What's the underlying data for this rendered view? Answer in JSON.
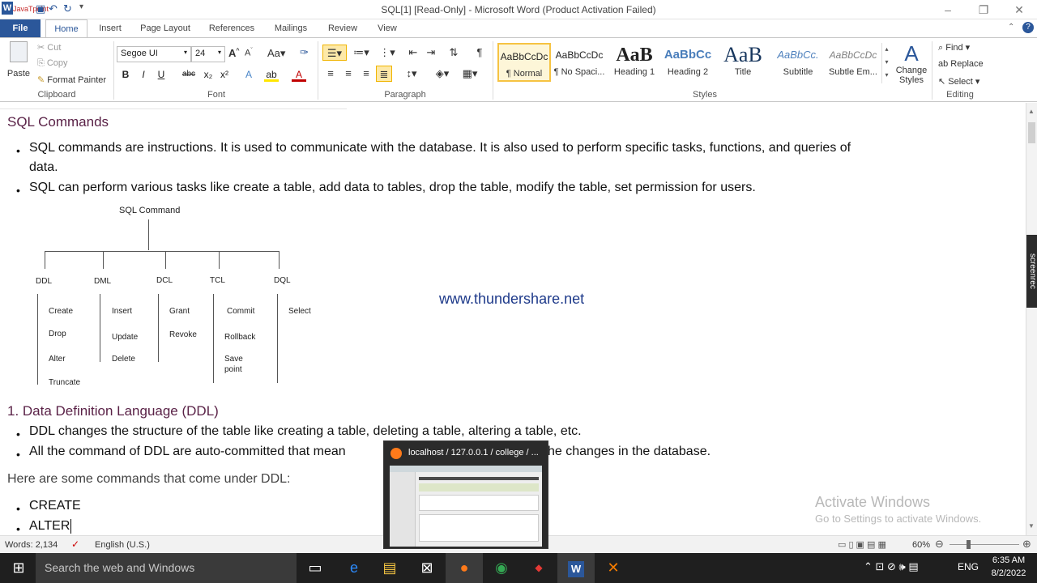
{
  "window": {
    "title": "SQL[1] [Read-Only] - Microsoft Word (Product Activation Failed)",
    "logo_text": "JavaTpoint"
  },
  "tabs": [
    "File",
    "Home",
    "Insert",
    "Page Layout",
    "References",
    "Mailings",
    "Review",
    "View"
  ],
  "clipboard": {
    "paste": "Paste",
    "cut": "Cut",
    "copy": "Copy",
    "format_painter": "Format Painter",
    "label": "Clipboard"
  },
  "font": {
    "name": "Segoe UI",
    "size": "24",
    "label": "Font"
  },
  "paragraph": {
    "label": "Paragraph"
  },
  "styles": {
    "label": "Styles",
    "items": [
      {
        "preview": "AaBbCcDc",
        "name": "¶ Normal"
      },
      {
        "preview": "AaBbCcDc",
        "name": "¶ No Spaci..."
      },
      {
        "preview": "AaB",
        "name": "Heading 1"
      },
      {
        "preview": "AaBbCc",
        "name": "Heading 2"
      },
      {
        "preview": "AaB",
        "name": "Title"
      },
      {
        "preview": "AaBbCc.",
        "name": "Subtitle"
      },
      {
        "preview": "AaBbCcDc",
        "name": "Subtle Em..."
      }
    ],
    "change_styles": "Change Styles"
  },
  "editing": {
    "find": "Find",
    "replace": "Replace",
    "select": "Select",
    "label": "Editing"
  },
  "doc": {
    "heading1": "SQL Commands",
    "bullets1": [
      "SQL commands are instructions. It is used to communicate with the database. It is also used to perform specific tasks, functions, and queries of",
      "data.",
      "SQL can perform various tasks like create a table, add data to tables, drop the table, modify the table, set permission for users."
    ],
    "diagram": {
      "root": "SQL Command",
      "branches": [
        {
          "name": "DDL",
          "items": [
            "Create",
            "Drop",
            "Alter",
            "Truncate"
          ]
        },
        {
          "name": "DML",
          "items": [
            "Insert",
            "Update",
            "Delete"
          ]
        },
        {
          "name": "DCL",
          "items": [
            "Grant",
            "Revoke"
          ]
        },
        {
          "name": "TCL",
          "items": [
            "Commit",
            "Rollback",
            "Save point"
          ]
        },
        {
          "name": "DQL",
          "items": [
            "Select"
          ]
        }
      ]
    },
    "watermark": "www.thundershare.net",
    "heading2": "1. Data Definition Language (DDL)",
    "bullets2": [
      "DDL changes the structure of the table like creating a table, deleting a table, altering a table, etc.",
      "All the command of DDL are auto-committed that mean",
      "he changes in the database."
    ],
    "intro": "Here are some commands that come under DDL:",
    "cmds": [
      "CREATE",
      "ALTER"
    ],
    "activate_title": "Activate Windows",
    "activate_sub": "Go to Settings to activate Windows."
  },
  "status": {
    "words": "Words: 2,134",
    "language": "English (U.S.)",
    "zoom": "60%"
  },
  "taskbar": {
    "search": "Search the web and Windows",
    "time": "6:35 AM",
    "date": "8/2/2022",
    "lang": "ENG"
  },
  "popup": {
    "title": "localhost / 127.0.0.1 / college / ..."
  },
  "side_badge": "screenrec"
}
